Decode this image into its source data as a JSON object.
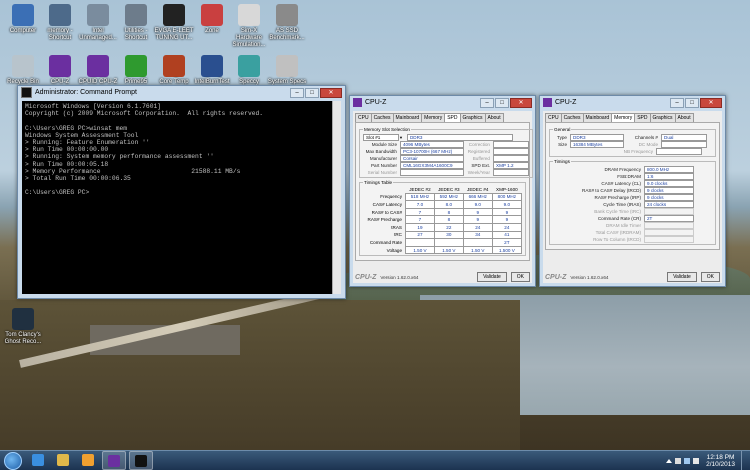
{
  "desktop_icons": [
    {
      "label": "Computer",
      "icon": "computer-icon",
      "color": "#3b6fb5"
    },
    {
      "label": "memory - Shortcut",
      "icon": "memory-shortcut-icon",
      "color": "#4d6a8a"
    },
    {
      "label": "Intel Unmanaged...",
      "icon": "intel-icon",
      "color": "#7a8c9e"
    },
    {
      "label": "Utilities - Shortcut",
      "icon": "utilities-icon",
      "color": "#6d7c8b"
    },
    {
      "label": "EVGA E-LEET TUNING UT...",
      "icon": "evga-icon",
      "color": "#222222"
    },
    {
      "label": "Zone",
      "icon": "zone-icon",
      "color": "#c94040"
    },
    {
      "label": "Sim-X Hardware Simulation...",
      "icon": "gamepad-icon",
      "color": "#d8d8d8"
    },
    {
      "label": "AS SSD Benchmark...",
      "icon": "ssd-icon",
      "color": "#8a8a8a"
    },
    {
      "label": "Recycle Bin",
      "icon": "recycle-bin-icon",
      "color": "#b8c4cc"
    },
    {
      "label": "CPUID CPU-Z",
      "icon": "cpuz-icon",
      "color": "#6b2fa0"
    },
    {
      "label": "CPU-Z",
      "icon": "cpuz-icon",
      "color": "#6b2fa0"
    },
    {
      "label": "Prime95",
      "icon": "prime95-icon",
      "color": "#2f9a2f"
    },
    {
      "label": "Core Temp",
      "icon": "coretemp-icon",
      "color": "#b04020"
    },
    {
      "label": "IntelBurnTest",
      "icon": "intel-burn-icon",
      "color": "#2a4f8f"
    },
    {
      "label": "Speccy",
      "icon": "speccy-icon",
      "color": "#3aa0a0"
    },
    {
      "label": "System Specs",
      "icon": "specs-icon",
      "color": "#c0c0c0"
    },
    {
      "label": "Tom Clancy's Ghost Reco...",
      "icon": "ghost-recon-icon",
      "color": "#203040"
    }
  ],
  "cmd": {
    "title": "Administrator: Command Prompt",
    "lines": [
      "Microsoft Windows [Version 6.1.7601]",
      "Copyright (c) 2009 Microsoft Corporation.  All rights reserved.",
      "",
      "C:\\Users\\GREG PC>winsat mem",
      "Windows System Assessment Tool",
      "> Running: Feature Enumeration ''",
      "> Run Time 00:00:00.00",
      "> Running: System memory performance assessment ''",
      "> Run Time 00:00:05.18",
      "> Memory Performance                        21588.11 MB/s",
      "> Total Run Time 00:00:06.35",
      "",
      "C:\\Users\\GREG PC>"
    ]
  },
  "cpuz_spd": {
    "title": "CPU-Z",
    "tabs": [
      "CPU",
      "Caches",
      "Mainboard",
      "Memory",
      "SPD",
      "Graphics",
      "About"
    ],
    "active_tab": "SPD",
    "slot_section": "Memory Slot Selection",
    "slot": "Slot #1",
    "memory_type": "DDR3",
    "fields": [
      {
        "label": "Module Size",
        "value": "4096 MBytes",
        "label2": "Correction",
        "value2": ""
      },
      {
        "label": "Max Bandwidth",
        "value": "PC3-10700H (667 MHz)",
        "label2": "Registered",
        "value2": ""
      },
      {
        "label": "Manufacturer",
        "value": "Corsair",
        "label2": "Buffered",
        "value2": ""
      },
      {
        "label": "Part Number",
        "value": "CML16GX3M4A1600C9",
        "label2": "SPD Ext.",
        "value2": "XMP 1.2"
      },
      {
        "label": "Serial Number",
        "value": "",
        "label2": "Week/Year",
        "value2": ""
      }
    ],
    "timings_section": "Timings Table",
    "timing_cols": [
      "JEDEC #2",
      "JEDEC #3",
      "JEDEC #4",
      "XMP-1600"
    ],
    "timing_rows": [
      {
        "label": "Frequency",
        "values": [
          "518 MHz",
          "592 MHz",
          "666 MHz",
          "800 MHz"
        ]
      },
      {
        "label": "CAS# Latency",
        "values": [
          "7.0",
          "8.0",
          "9.0",
          "9.0"
        ]
      },
      {
        "label": "RAS# to CAS#",
        "values": [
          "7",
          "8",
          "9",
          "9"
        ]
      },
      {
        "label": "RAS# Precharge",
        "values": [
          "7",
          "8",
          "9",
          "9"
        ]
      },
      {
        "label": "tRAS",
        "values": [
          "19",
          "22",
          "24",
          "24"
        ]
      },
      {
        "label": "tRC",
        "values": [
          "27",
          "30",
          "34",
          "41"
        ]
      },
      {
        "label": "Command Rate",
        "values": [
          "",
          "",
          "",
          "2T"
        ]
      },
      {
        "label": "Voltage",
        "values": [
          "1.50 V",
          "1.50 V",
          "1.50 V",
          "1.500 V"
        ]
      }
    ],
    "version": "Version 1.62.0.x64",
    "validate": "Validate",
    "ok": "OK"
  },
  "cpuz_mem": {
    "title": "CPU-Z",
    "tabs": [
      "CPU",
      "Caches",
      "Mainboard",
      "Memory",
      "SPD",
      "Graphics",
      "About"
    ],
    "active_tab": "Memory",
    "general_section": "General",
    "type_label": "Type",
    "type_value": "DDR3",
    "size_label": "Size",
    "size_value": "16384 MBytes",
    "channels_label": "Channels #",
    "channels_value": "Dual",
    "dcmode_label": "DC Mode",
    "nb_label": "NB Frequency",
    "timings_section": "Timings",
    "timings": [
      {
        "label": "DRAM Frequency",
        "value": "800.0 MHz",
        "dim": false
      },
      {
        "label": "FSB:DRAM",
        "value": "1:6",
        "dim": false
      },
      {
        "label": "CAS# Latency (CL)",
        "value": "9.0 clocks",
        "dim": false
      },
      {
        "label": "RAS# to CAS# Delay (tRCD)",
        "value": "9 clocks",
        "dim": false
      },
      {
        "label": "RAS# Precharge (tRP)",
        "value": "9 clocks",
        "dim": false
      },
      {
        "label": "Cycle Time (tRAS)",
        "value": "24 clocks",
        "dim": false
      },
      {
        "label": "Bank Cycle Time (tRC)",
        "value": "",
        "dim": true
      },
      {
        "label": "Command Rate (CR)",
        "value": "2T",
        "dim": false
      },
      {
        "label": "DRAM Idle Timer",
        "value": "",
        "dim": true
      },
      {
        "label": "Total CAS# (tRDRAM)",
        "value": "",
        "dim": true
      },
      {
        "label": "Row To Column (tRCD)",
        "value": "",
        "dim": true
      }
    ],
    "version": "Version 1.62.0.x64",
    "validate": "Validate",
    "ok": "OK"
  },
  "taskbar": {
    "apps": [
      {
        "name": "ie",
        "icon": "internet-explorer-icon",
        "color": "#3a8fe0",
        "open": false
      },
      {
        "name": "explorer",
        "icon": "folder-icon",
        "color": "#e0b84a",
        "open": false
      },
      {
        "name": "media",
        "icon": "media-player-icon",
        "color": "#f0a030",
        "open": false
      },
      {
        "name": "cpuz",
        "icon": "cpuz-taskbar-icon",
        "color": "#6b2fa0",
        "open": true
      },
      {
        "name": "cmd",
        "icon": "cmd-taskbar-icon",
        "color": "#111111",
        "open": true
      }
    ],
    "time": "12:18 PM",
    "date": "2/10/2013"
  }
}
